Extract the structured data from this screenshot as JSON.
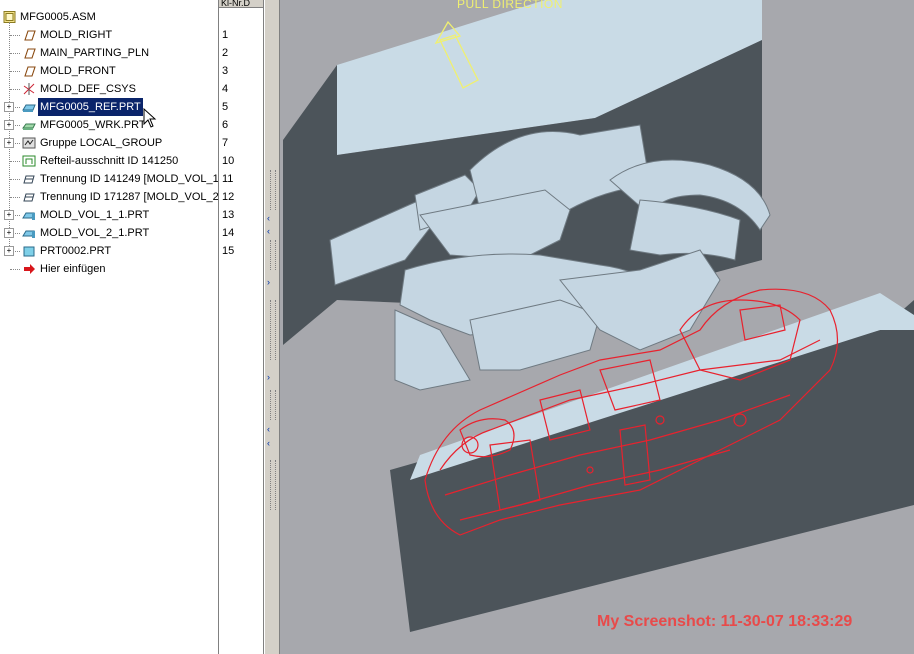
{
  "tree": {
    "root": {
      "label": "MFG0005.ASM"
    },
    "items": [
      {
        "label": "MOLD_RIGHT",
        "num": "1",
        "icon": "datum-plane-icon",
        "expandable": false
      },
      {
        "label": "MAIN_PARTING_PLN",
        "num": "2",
        "icon": "datum-plane-icon",
        "expandable": false
      },
      {
        "label": "MOLD_FRONT",
        "num": "3",
        "icon": "datum-plane-icon",
        "expandable": false
      },
      {
        "label": "MOLD_DEF_CSYS",
        "num": "4",
        "icon": "coordinate-system-icon",
        "expandable": false
      },
      {
        "label": "MFG0005_REF.PRT",
        "num": "5",
        "icon": "reference-part-icon",
        "expandable": true,
        "selected": true
      },
      {
        "label": "MFG0005_WRK.PRT",
        "num": "6",
        "icon": "workpiece-icon",
        "expandable": true
      },
      {
        "label": "Gruppe LOCAL_GROUP",
        "num": "7",
        "icon": "group-icon",
        "expandable": true
      },
      {
        "label": "Refteil-ausschnitt ID 141250",
        "num": "10",
        "icon": "ref-cutout-icon",
        "expandable": false
      },
      {
        "label": "Trennung ID 141249 [MOLD_VOL_1",
        "num": "11",
        "icon": "split-feature-icon",
        "expandable": false
      },
      {
        "label": "Trennung ID 171287 [MOLD_VOL_2",
        "num": "12",
        "icon": "split-feature-icon",
        "expandable": false
      },
      {
        "label": "MOLD_VOL_1_1.PRT",
        "num": "13",
        "icon": "mold-volume-icon",
        "expandable": true
      },
      {
        "label": "MOLD_VOL_2_1.PRT",
        "num": "14",
        "icon": "mold-volume-icon",
        "expandable": true
      },
      {
        "label": "PRT0002.PRT",
        "num": "15",
        "icon": "part-icon",
        "expandable": true
      },
      {
        "label": "Hier einfügen",
        "num": "",
        "icon": "insert-here-arrow-icon",
        "expandable": false
      }
    ]
  },
  "num_column": {
    "header": "Kl-Nr.D"
  },
  "viewport": {
    "pull_direction_label": "PULL DIRECTION",
    "screenshot_stamp": "My Screenshot: 11-30-07 18:33:29",
    "colors": {
      "background": "#a7a8ad",
      "plate_face": "#c9dbe6",
      "plate_side": "#4c545a",
      "part_wire": "#e8222e",
      "stamp": "#e84a4a",
      "pull": "#f0f070"
    }
  }
}
